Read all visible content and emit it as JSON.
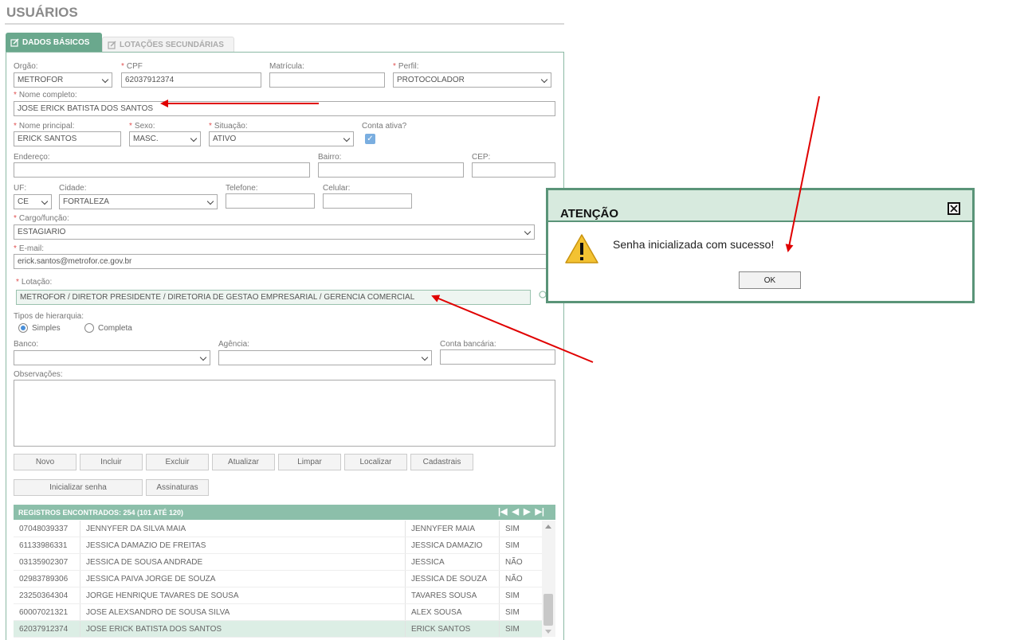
{
  "page": {
    "title": "USUÁRIOS"
  },
  "tabs": [
    {
      "label": "DADOS BÁSICOS",
      "active": true
    },
    {
      "label": "LOTAÇÕES SECUNDÁRIAS",
      "active": false
    }
  ],
  "form": {
    "orgao": {
      "label": "Orgão:",
      "value": "METROFOR"
    },
    "cpf": {
      "label": "CPF",
      "value": "62037912374"
    },
    "matricula": {
      "label": "Matrícula:",
      "value": ""
    },
    "perfil": {
      "label": "Perfil:",
      "value": "PROTOCOLADOR"
    },
    "nome_completo": {
      "label": "Nome completo:",
      "value": "JOSE ERICK BATISTA DOS SANTOS"
    },
    "nome_principal": {
      "label": "Nome principal:",
      "value": "ERICK SANTOS"
    },
    "sexo": {
      "label": "Sexo:",
      "value": "MASC."
    },
    "situacao": {
      "label": "Situação:",
      "value": "ATIVO"
    },
    "conta_ativa": {
      "label": "Conta ativa?",
      "checked": true
    },
    "endereco": {
      "label": "Endereço:",
      "value": ""
    },
    "bairro": {
      "label": "Bairro:",
      "value": ""
    },
    "cep": {
      "label": "CEP:",
      "value": ""
    },
    "uf": {
      "label": "UF:",
      "value": "CE"
    },
    "cidade": {
      "label": "Cidade:",
      "value": "FORTALEZA"
    },
    "telefone": {
      "label": "Telefone:",
      "value": ""
    },
    "celular": {
      "label": "Celular:",
      "value": ""
    },
    "cargo": {
      "label": "Cargo/função:",
      "value": "ESTAGIARIO"
    },
    "email": {
      "label": "E-mail:",
      "value": "erick.santos@metrofor.ce.gov.br"
    },
    "lotacao": {
      "label": "Lotação:",
      "value": "METROFOR / DIRETOR PRESIDENTE / DIRETORIA DE GESTAO EMPRESARIAL / GERENCIA COMERCIAL"
    },
    "hierarquia": {
      "label": "Tipos de hierarquia:",
      "options": [
        "Simples",
        "Completa"
      ],
      "selected": "Simples"
    },
    "banco": {
      "label": "Banco:",
      "value": ""
    },
    "agencia": {
      "label": "Agência:",
      "value": ""
    },
    "conta_bancaria": {
      "label": "Conta bancária:",
      "value": ""
    },
    "observacoes": {
      "label": "Observações:",
      "value": ""
    }
  },
  "buttons": {
    "row1": [
      "Novo",
      "Incluir",
      "Excluir",
      "Atualizar",
      "Limpar",
      "Localizar",
      "Cadastrais"
    ],
    "row2": [
      "Inicializar senha",
      "Assinaturas"
    ]
  },
  "grid": {
    "header": "REGISTROS ENCONTRADOS: 254 (101 ATÉ 120)",
    "rows": [
      [
        "07048039337",
        "JENNYFER DA SILVA MAIA",
        "JENNYFER MAIA",
        "SIM"
      ],
      [
        "61133986331",
        "JESSICA DAMAZIO DE FREITAS",
        "JESSICA DAMAZIO",
        "SIM"
      ],
      [
        "03135902307",
        "JESSICA DE SOUSA ANDRADE",
        "JESSICA",
        "NÃO"
      ],
      [
        "02983789306",
        "JESSICA PAIVA JORGE DE SOUZA",
        "JESSICA DE SOUZA",
        "NÃO"
      ],
      [
        "23250364304",
        "JORGE HENRIQUE TAVARES DE SOUSA",
        "TAVARES SOUSA",
        "SIM"
      ],
      [
        "60007021321",
        "JOSE ALEXSANDRO DE SOUSA SILVA",
        "ALEX SOUSA",
        "SIM"
      ],
      [
        "62037912374",
        "JOSE ERICK BATISTA DOS SANTOS",
        "ERICK SANTOS",
        "SIM"
      ]
    ],
    "selected_row": 6
  },
  "dialog": {
    "title": "ATENÇÃO",
    "message": "Senha inicializada com sucesso!",
    "ok_label": "OK",
    "icon": "warning-icon"
  },
  "colors": {
    "accent": "#6aa88d",
    "dialog_border": "#5a9478",
    "annotation_arrow": "#e00000"
  }
}
